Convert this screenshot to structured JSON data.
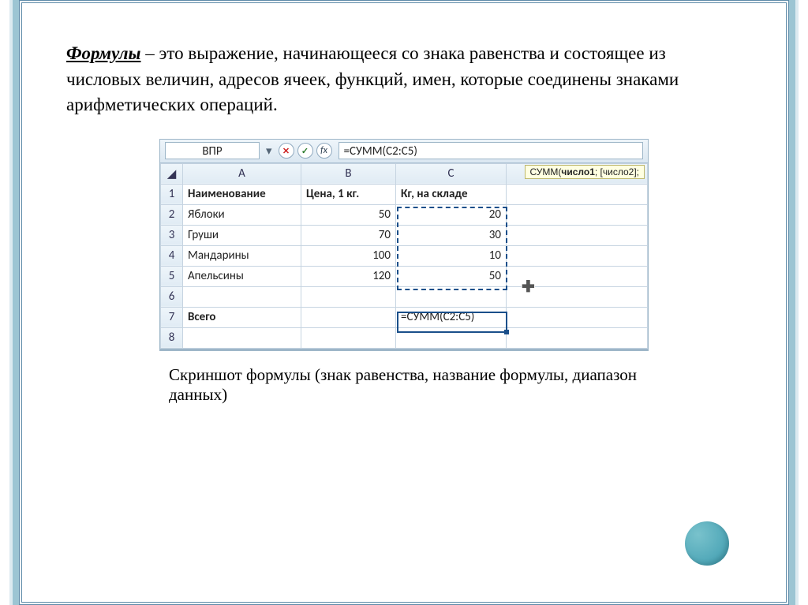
{
  "definition": {
    "term": "Формулы",
    "text": " – это выражение, начинающееся со знака равенства и состоящее из числовых величин, адресов ячеек, функций, имен, которые соединены знаками арифметических операций."
  },
  "excel": {
    "name_box": "ВПР",
    "fx": "fx",
    "formula": "=СУММ(C2:C5)",
    "tooltip": {
      "fn": "СУММ",
      "bold": "число1",
      "rest": "; [число2];"
    },
    "columns": [
      "A",
      "B",
      "C"
    ],
    "header_row": [
      "Наименование",
      "Цена, 1 кг.",
      "Кг, на складе"
    ],
    "rows": [
      {
        "n": "2",
        "name": "Яблоки",
        "price": "50",
        "qty": "20"
      },
      {
        "n": "3",
        "name": "Груши",
        "price": "70",
        "qty": "30"
      },
      {
        "n": "4",
        "name": "Мандарины",
        "price": "100",
        "qty": "10"
      },
      {
        "n": "5",
        "name": "Апельсины",
        "price": "120",
        "qty": "50"
      }
    ],
    "total_label": "Всего",
    "total_cell": "=СУММ(C2:C5)",
    "row_numbers": [
      "1",
      "2",
      "3",
      "4",
      "5",
      "6",
      "7",
      "8"
    ]
  },
  "caption": "Скриншот формулы (знак равенства, название формулы, диапазон данных)"
}
